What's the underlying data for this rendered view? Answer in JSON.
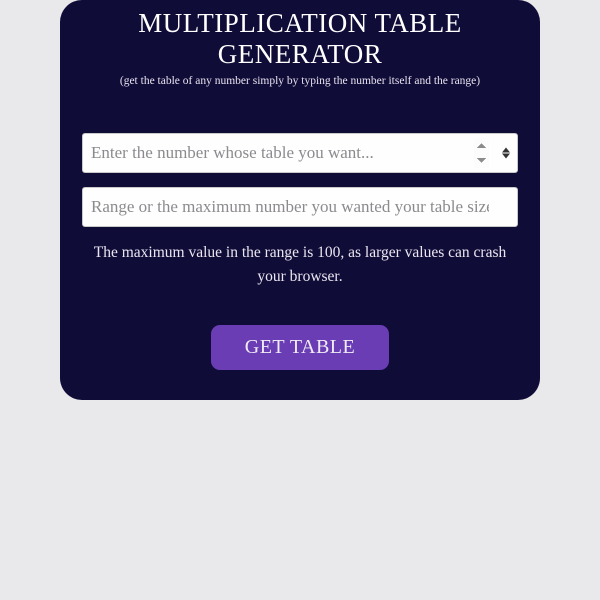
{
  "header": {
    "title": "MULTIPLICATION TABLE GENERATOR",
    "subtitle": "(get the table of any number simply by typing the number itself and the range)"
  },
  "form": {
    "number_input": {
      "placeholder": "Enter the number whose table you want...",
      "value": ""
    },
    "range_input": {
      "placeholder": "Range or the maximum number you wanted your table sized...",
      "value": ""
    },
    "helper_text": "The maximum value in the range is 100, as larger values can crash your browser.",
    "submit_label": "GET TABLE"
  },
  "colors": {
    "card_bg": "#100c38",
    "button_bg": "#6a3db5",
    "page_bg": "#e9e8ea"
  }
}
